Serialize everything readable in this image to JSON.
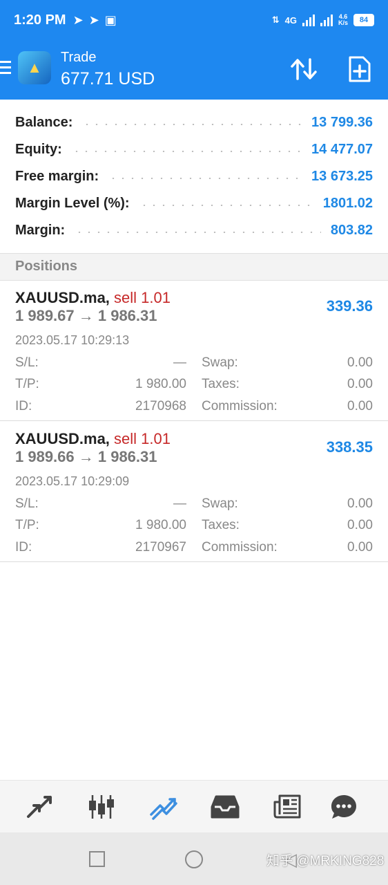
{
  "status_bar": {
    "time": "1:20 PM",
    "network": "4G",
    "speed": "4.6",
    "speed_unit": "K/s",
    "battery": "84"
  },
  "header": {
    "title": "Trade",
    "balance": "677.71 USD"
  },
  "summary": [
    {
      "label": "Balance:",
      "value": "13 799.36"
    },
    {
      "label": "Equity:",
      "value": "14 477.07"
    },
    {
      "label": "Free margin:",
      "value": "13 673.25"
    },
    {
      "label": "Margin Level (%):",
      "value": "1801.02"
    },
    {
      "label": "Margin:",
      "value": "803.82"
    }
  ],
  "positions_header": "Positions",
  "positions": [
    {
      "symbol": "XAUUSD.ma,",
      "side": "sell 1.01",
      "prices": "1 989.67 → 1 986.31",
      "profit": "339.36",
      "time": "2023.05.17 10:29:13",
      "sl_label": "S/L:",
      "sl": "—",
      "tp_label": "T/P:",
      "tp": "1 980.00",
      "id_label": "ID:",
      "id": "2170968",
      "swap_label": "Swap:",
      "swap": "0.00",
      "taxes_label": "Taxes:",
      "taxes": "0.00",
      "commission_label": "Commission:",
      "commission": "0.00"
    },
    {
      "symbol": "XAUUSD.ma,",
      "side": "sell 1.01",
      "prices": "1 989.66 → 1 986.31",
      "profit": "338.35",
      "time": "2023.05.17 10:29:09",
      "sl_label": "S/L:",
      "sl": "—",
      "tp_label": "T/P:",
      "tp": "1 980.00",
      "id_label": "ID:",
      "id": "2170967",
      "swap_label": "Swap:",
      "swap": "0.00",
      "taxes_label": "Taxes:",
      "taxes": "0.00",
      "commission_label": "Commission:",
      "commission": "0.00"
    }
  ],
  "tabs": [
    {
      "name": "quotes-icon",
      "active": false
    },
    {
      "name": "chart-candles-icon",
      "active": false
    },
    {
      "name": "trade-icon",
      "active": true
    },
    {
      "name": "history-inbox-icon",
      "active": false
    },
    {
      "name": "news-icon",
      "active": false
    },
    {
      "name": "chat-icon",
      "active": false
    }
  ],
  "watermark": "知乎 @MRKING828",
  "colors": {
    "accent": "#1e88f0",
    "value_blue": "#1e88e5",
    "sell_red": "#c62828"
  }
}
